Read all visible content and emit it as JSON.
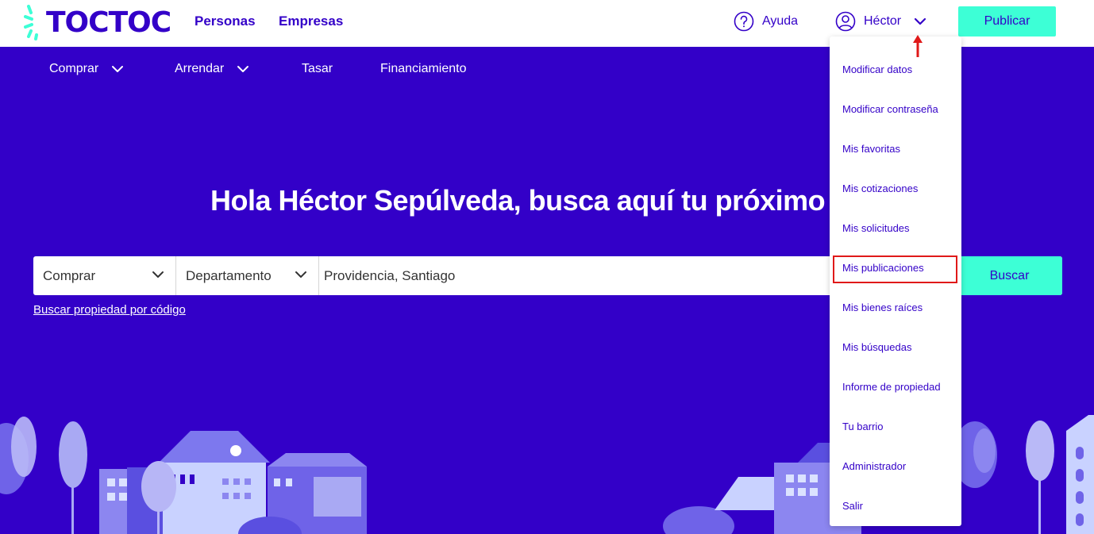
{
  "header": {
    "brand": "TOCTOC",
    "nav": [
      "Personas",
      "Empresas"
    ],
    "help_label": "Ayuda",
    "user_name": "Héctor",
    "publish_label": "Publicar"
  },
  "subnav": [
    {
      "label": "Comprar",
      "has_dropdown": true
    },
    {
      "label": "Arrendar",
      "has_dropdown": true
    },
    {
      "label": "Tasar",
      "has_dropdown": false
    },
    {
      "label": "Financiamiento",
      "has_dropdown": false
    }
  ],
  "hero": {
    "title": "Hola Héctor Sepúlveda, busca aquí tu próximo ho"
  },
  "search": {
    "operation_value": "Comprar",
    "property_type_value": "Departamento",
    "location_value": "Providencia, Santiago",
    "button_label": "Buscar",
    "code_link": "Buscar propiedad por código"
  },
  "user_dropdown": {
    "items": [
      "Modificar datos",
      "Modificar contraseña",
      "Mis favoritas",
      "Mis cotizaciones",
      "Mis solicitudes",
      "Mis publicaciones",
      "Mis bienes raíces",
      "Mis búsquedas",
      "Informe de propiedad",
      "Tu barrio",
      "Administrador",
      "Salir"
    ],
    "highlighted_item": "Mis publicaciones"
  },
  "colors": {
    "brand_purple": "#3300c8",
    "accent_aqua": "#3dffd6",
    "highlight_red": "#e01919"
  }
}
